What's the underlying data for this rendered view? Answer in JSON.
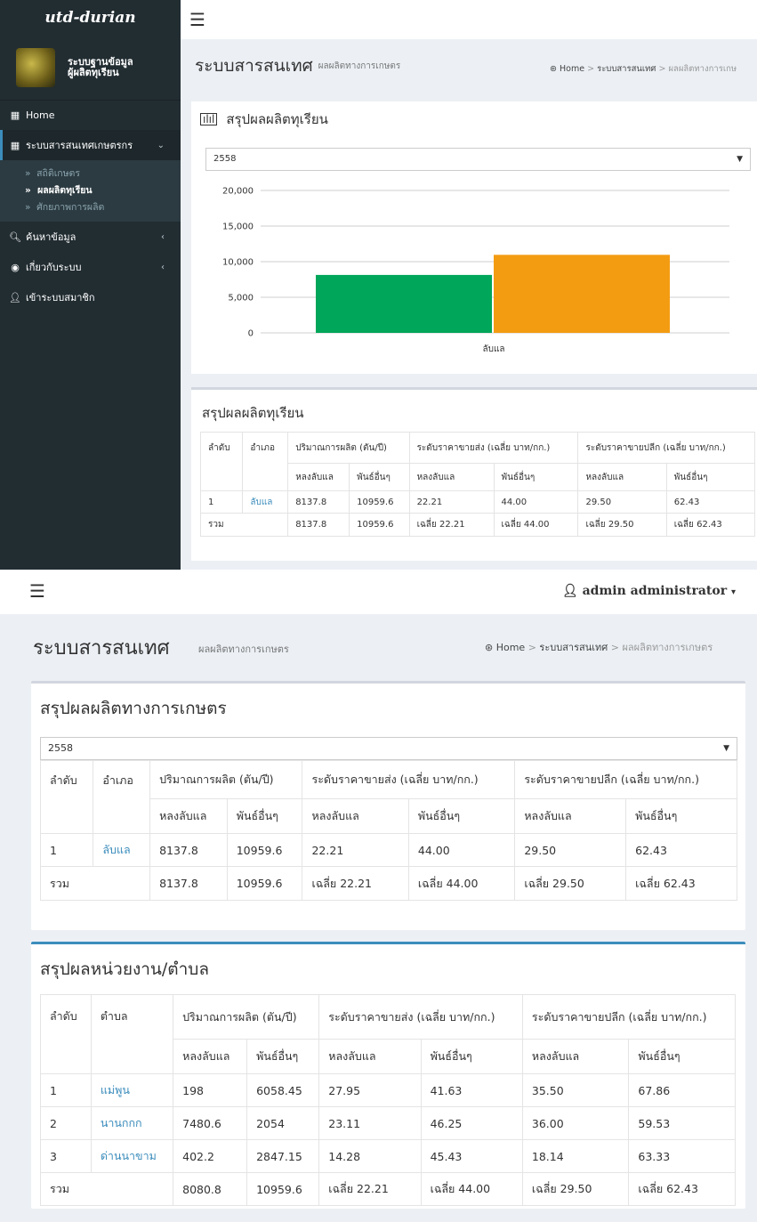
{
  "s1": {
    "logo": "utd-durian",
    "user_panel": "ระบบฐานข้อมูล\nผู้ผลิตทุเรียน",
    "sidebar": {
      "home": "Home",
      "menu_info": "ระบบสารสนเทศเกษตรกร",
      "sub_items": [
        "สถิติเกษตร",
        "ผลผลิตทุเรียน",
        "ศักยภาพการผลิต"
      ],
      "search": "ค้นหาข้อมูล",
      "about": "เกี่ยวกับระบบ",
      "login": "เข้าระบบสมาชิก"
    },
    "page_title": "ระบบสารสนเทศ",
    "page_subtitle": "ผลผลิตทางการเกษตร",
    "breadcrumb": [
      "Home",
      "ระบบสารสนเทศ",
      "ผลผลิตทางการเกษ"
    ],
    "chart_box_title": "สรุปผลผลิตทุเรียน",
    "year_select": "2558",
    "table_title": "สรุปผลผลิตทุเรียน",
    "headers": {
      "order": "ลำดับ",
      "district": "อำเภอ",
      "production": "ปริมาณการผลิต (ตัน/ปี)",
      "wholesale": "ระดับราคาขายส่ง (เฉลี่ย บาท/กก.)",
      "retail": "ระดับราคาขายปลีก (เฉลี่ย บาท/กก.)",
      "lang": "หลงลับแล",
      "other": "พันธ์อื่นๆ"
    },
    "row": [
      "1",
      "ลับแล",
      "8137.8",
      "10959.6",
      "22.21",
      "44.00",
      "29.50",
      "62.43"
    ],
    "total": [
      "รวม",
      "8137.8",
      "10959.6",
      "เฉลี่ย 22.21",
      "เฉลี่ย 44.00",
      "เฉลี่ย 29.50",
      "เฉลี่ย 62.43"
    ]
  },
  "chart_data": {
    "type": "bar",
    "categories": [
      "ลับแล"
    ],
    "series": [
      {
        "values": [
          8137.8
        ],
        "color": "#00a65a"
      },
      {
        "values": [
          10959.6
        ],
        "color": "#f39c12"
      }
    ],
    "y_ticks": [
      "20,000",
      "15,000",
      "10,000",
      "5,000",
      "0"
    ],
    "ylim": [
      0,
      20000
    ],
    "grid": true
  },
  "s2": {
    "user": "admin administrator",
    "page_title": "ระบบสารสนเทศ",
    "page_subtitle": "ผลผลิตทางการเกษตร",
    "breadcrumb": [
      "Home",
      "ระบบสารสนเทศ",
      "ผลผลิตทางการเกษตร"
    ],
    "box1_title": "สรุปผลผลิตทางการเกษตร",
    "year_select": "2558",
    "box2_title": "สรุปผลหน่วยงาน/ตำบล",
    "sub_header": "ตำบล",
    "rows2": [
      [
        "1",
        "แม่พูน",
        "198",
        "6058.45",
        "27.95",
        "41.63",
        "35.50",
        "67.86"
      ],
      [
        "2",
        "นานกกก",
        "7480.6",
        "2054",
        "23.11",
        "46.25",
        "36.00",
        "59.53"
      ],
      [
        "3",
        "ด่านนาขาม",
        "402.2",
        "2847.15",
        "14.28",
        "45.43",
        "18.14",
        "63.33"
      ]
    ],
    "total2": [
      "รวม",
      "8080.8",
      "10959.6",
      "เฉลี่ย 22.21",
      "เฉลี่ย 44.00",
      "เฉลี่ย 29.50",
      "เฉลี่ย 62.43"
    ]
  }
}
